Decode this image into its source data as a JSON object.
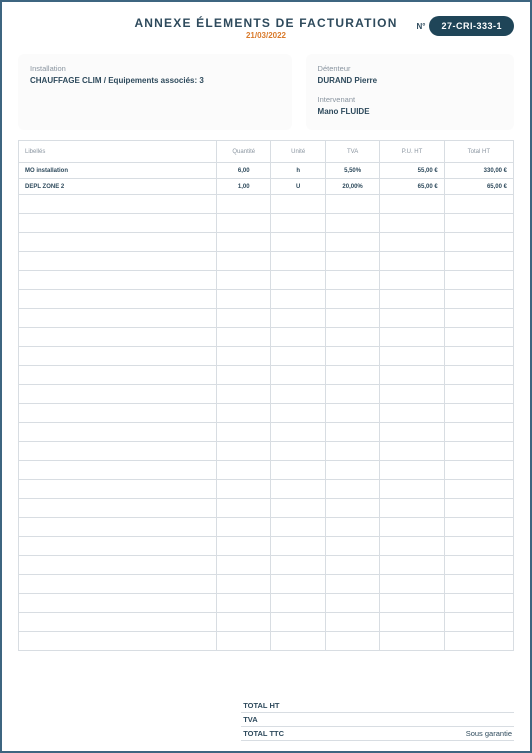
{
  "header": {
    "title": "ANNEXE ÉLEMENTS DE FACTURATION",
    "date": "21/03/2022",
    "n_label": "N°",
    "doc_id": "27-CRI-333-1"
  },
  "install": {
    "label": "Installation",
    "value": "CHAUFFAGE CLIM / Equipements associés: 3"
  },
  "holder": {
    "label": "Détenteur",
    "value": "DURAND Pierre"
  },
  "operator": {
    "label": "Intervenant",
    "value": "Mano FLUIDE"
  },
  "table": {
    "headers": {
      "label": "Libellés",
      "qty": "Quantité",
      "unit": "Unité",
      "tva": "TVA",
      "pu": "P.U. HT",
      "total": "Total HT"
    },
    "rows": [
      {
        "label": "MO installation",
        "qty": "6,00",
        "unit": "h",
        "tva": "5,50%",
        "pu": "55,00 €",
        "total": "330,00 €"
      },
      {
        "label": "DEPL ZONE 2",
        "qty": "1,00",
        "unit": "U",
        "tva": "20,00%",
        "pu": "65,00 €",
        "total": "65,00 €"
      }
    ],
    "empty_rows": 24
  },
  "totals": {
    "ht_label": "TOTAL HT",
    "ht_value": "",
    "tva_label": "TVA",
    "tva_value": "",
    "ttc_label": "TOTAL TTC",
    "ttc_value": "Sous garantie"
  }
}
